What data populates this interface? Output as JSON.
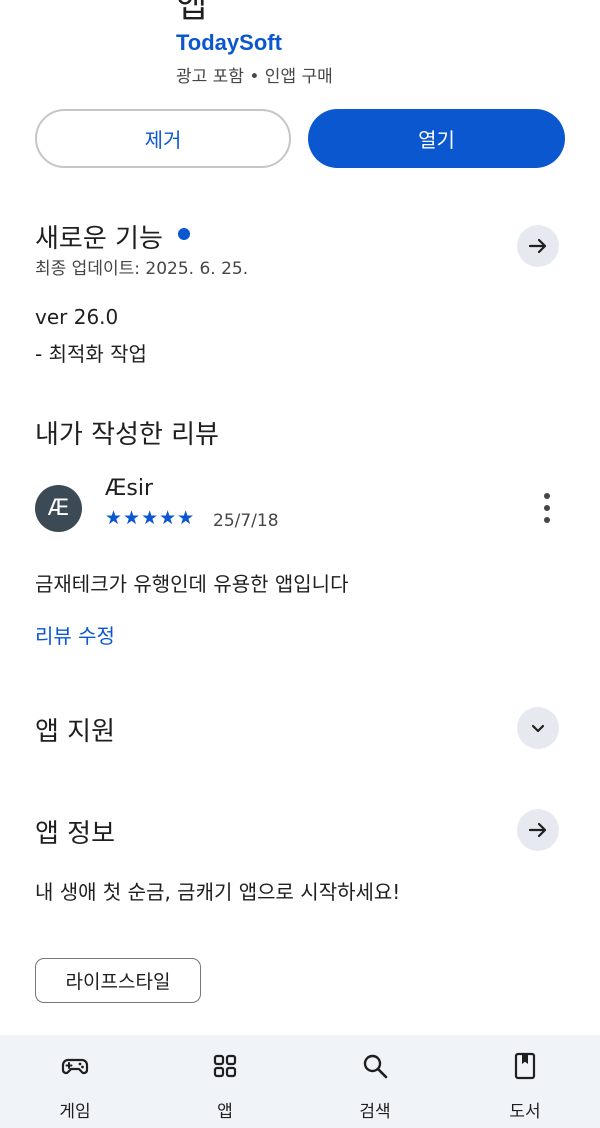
{
  "header": {
    "partial_title": "앱",
    "developer": "TodaySoft",
    "meta": "광고 포함 • 인앱 구매"
  },
  "actions": {
    "remove_label": "제거",
    "open_label": "열기"
  },
  "whats_new": {
    "title": "새로운 기능",
    "updated": "최종 업데이트: 2025. 6. 25.",
    "version": "ver 26.0",
    "note": "- 최적화 작업"
  },
  "my_review": {
    "title": "내가 작성한 리뷰",
    "avatar_text": "Æ",
    "reviewer": "Æsir",
    "stars": "★★★★★",
    "rating": 5,
    "date": "25/7/18",
    "text": "금재테크가 유행인데 유용한 앱입니다",
    "edit_label": "리뷰 수정"
  },
  "app_support": {
    "title": "앱 지원"
  },
  "app_info": {
    "title": "앱 정보",
    "tagline": "내 생애 첫 순금, 금캐기 앱으로 시작하세요!",
    "category_chip": "라이프스타일"
  },
  "bottom_nav": {
    "items": [
      {
        "label": "게임",
        "icon": "gamepad-icon"
      },
      {
        "label": "앱",
        "icon": "apps-grid-icon"
      },
      {
        "label": "검색",
        "icon": "search-icon"
      },
      {
        "label": "도서",
        "icon": "book-icon"
      }
    ]
  },
  "colors": {
    "accent": "#0b57d0",
    "round_button_bg": "#e6e9f0",
    "nav_bg": "#f0f4f9",
    "avatar_bg": "#3b4a55"
  }
}
